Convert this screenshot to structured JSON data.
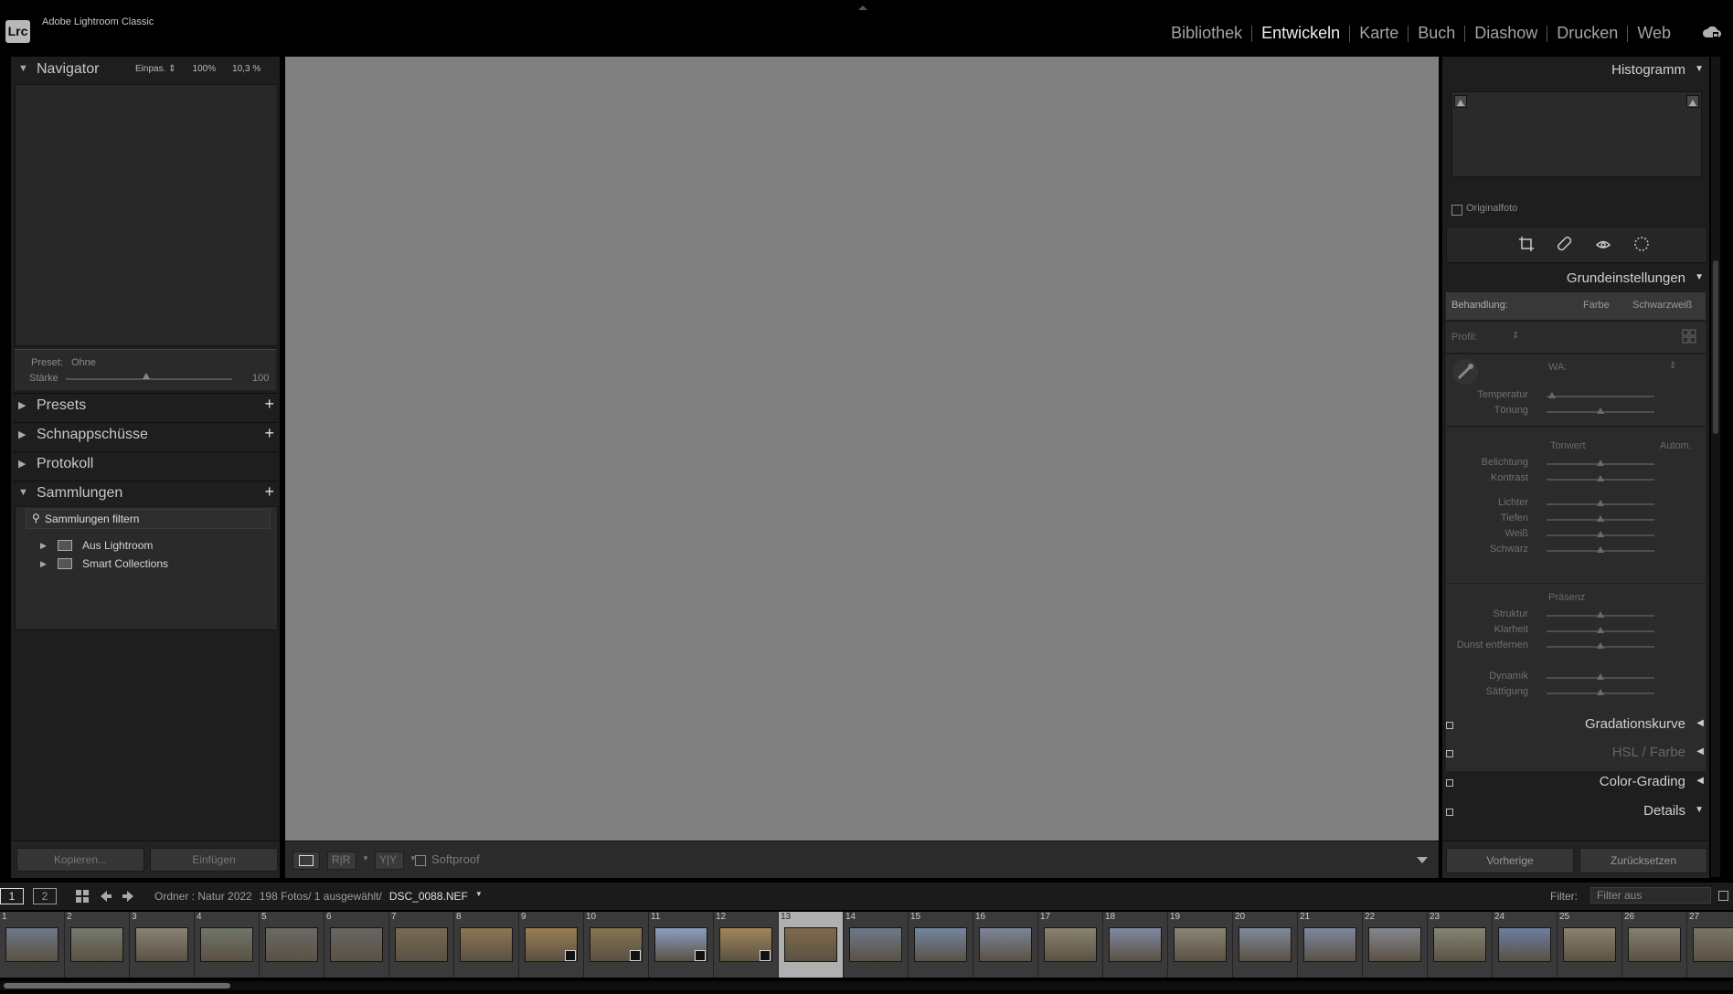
{
  "app": {
    "logo": "Lrc",
    "title": "Adobe Lightroom Classic"
  },
  "modules": [
    "Bibliothek",
    "Entwickeln",
    "Karte",
    "Buch",
    "Diashow",
    "Drucken",
    "Web"
  ],
  "active_module": "Entwickeln",
  "left": {
    "navigator": {
      "title": "Navigator",
      "zoom": [
        "Einpas. ⇕",
        "100%",
        "10,3 %"
      ]
    },
    "preset_label": "Preset:",
    "preset_value": "Ohne",
    "strength_label": "Stärke",
    "strength_value": "100",
    "panels": {
      "presets": "Presets",
      "snapshots": "Schnappschüsse",
      "history": "Protokoll",
      "collections": "Sammlungen"
    },
    "collections_filter": "Sammlungen filtern",
    "collections": [
      "Aus Lightroom",
      "Smart Collections"
    ],
    "copy_button": "Kopieren...",
    "paste_button": "Einfügen"
  },
  "toolbar": {
    "softproof": "Softproof"
  },
  "right": {
    "histogram_title": "Histogramm",
    "original_photo": "Originalfoto",
    "basic_title": "Grundeinstellungen",
    "treatment_label": "Behandlung:",
    "treatment_color": "Farbe",
    "treatment_bw": "Schwarzweiß",
    "profile_label": "Profil:",
    "wb_label": "WA:",
    "tone_label": "Tonwert",
    "auto_label": "Autom.",
    "presence_label": "Präsenz",
    "sliders_wb": [
      {
        "label": "Temperatur",
        "pos": 0.05
      },
      {
        "label": "Tönung",
        "pos": 0.5
      }
    ],
    "sliders_tone1": [
      {
        "label": "Belichtung",
        "pos": 0.5
      },
      {
        "label": "Kontrast",
        "pos": 0.5
      }
    ],
    "sliders_tone2": [
      {
        "label": "Lichter",
        "pos": 0.5
      },
      {
        "label": "Tiefen",
        "pos": 0.5
      },
      {
        "label": "Weiß",
        "pos": 0.5
      },
      {
        "label": "Schwarz",
        "pos": 0.5
      }
    ],
    "sliders_presence1": [
      {
        "label": "Struktur",
        "pos": 0.5
      },
      {
        "label": "Klarheit",
        "pos": 0.5
      },
      {
        "label": "Dunst entfernen",
        "pos": 0.5
      }
    ],
    "sliders_presence2": [
      {
        "label": "Dynamik",
        "pos": 0.5
      },
      {
        "label": "Sättigung",
        "pos": 0.5
      }
    ],
    "collapsed": [
      "Gradationskurve",
      "HSL / Farbe",
      "Color-Grading"
    ],
    "details_title": "Details",
    "prev_button": "Vorherige",
    "reset_button": "Zurücksetzen"
  },
  "filmstrip": {
    "page1": "1",
    "page2": "2",
    "source": "Ordner : Natur 2022",
    "count": "198 Fotos/ 1 ausgewählt/",
    "file": "DSC_0088.NEF",
    "filter_label": "Filter:",
    "filter_value": "Filter aus",
    "selected": 13,
    "thumbs": [
      {
        "n": "1",
        "c": "#6d7a88"
      },
      {
        "n": "2",
        "c": "#767a6e"
      },
      {
        "n": "3",
        "c": "#8a8373"
      },
      {
        "n": "4",
        "c": "#6f7669"
      },
      {
        "n": "5",
        "c": "#6a6a66"
      },
      {
        "n": "6",
        "c": "#676663"
      },
      {
        "n": "7",
        "c": "#7a6a52"
      },
      {
        "n": "8",
        "c": "#8d7650"
      },
      {
        "n": "9",
        "c": "#9a7e52"
      },
      {
        "n": "10",
        "c": "#86744f"
      },
      {
        "n": "11",
        "c": "#8a9fbf"
      },
      {
        "n": "12",
        "c": "#a1865a"
      },
      {
        "n": "13",
        "c": "#806a4a"
      },
      {
        "n": "14",
        "c": "#6e7a8a"
      },
      {
        "n": "15",
        "c": "#7386a0"
      },
      {
        "n": "16",
        "c": "#7c8598"
      },
      {
        "n": "17",
        "c": "#8b8470"
      },
      {
        "n": "18",
        "c": "#7f8aa0"
      },
      {
        "n": "19",
        "c": "#8a8574"
      },
      {
        "n": "20",
        "c": "#80899b"
      },
      {
        "n": "21",
        "c": "#7e889c"
      },
      {
        "n": "22",
        "c": "#83888e"
      },
      {
        "n": "23",
        "c": "#858675"
      },
      {
        "n": "24",
        "c": "#6c7ea0"
      },
      {
        "n": "25",
        "c": "#8a836d"
      },
      {
        "n": "26",
        "c": "#86806f"
      },
      {
        "n": "27",
        "c": "#7a7566"
      }
    ]
  }
}
